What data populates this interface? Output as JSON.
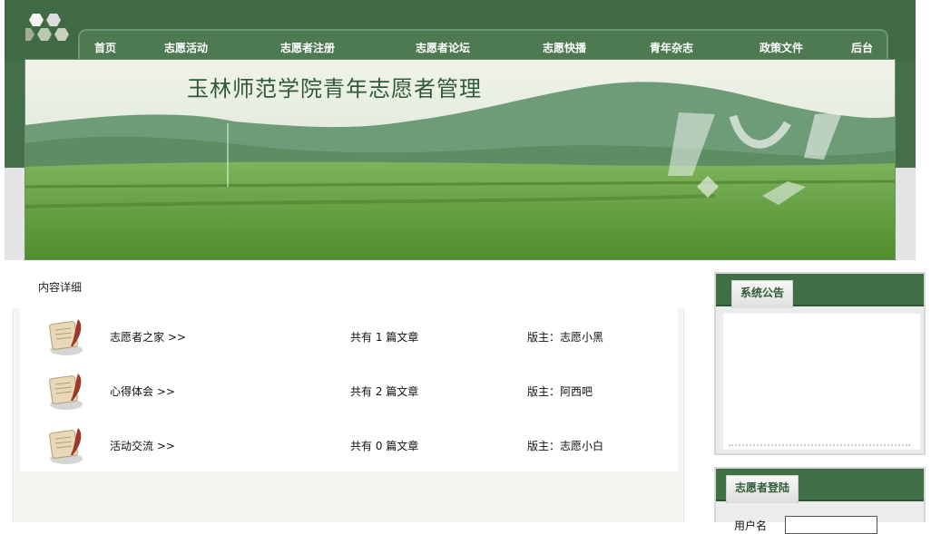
{
  "nav": {
    "items": [
      "首页",
      "志愿活动",
      "志愿者注册",
      "志愿者论坛",
      "志愿快播",
      "青年杂志",
      "政策文件",
      "后台"
    ]
  },
  "banner": {
    "title": "玉林师范学院青年志愿者管理"
  },
  "content": {
    "heading": "内容详细",
    "forums": [
      {
        "name": "志愿者之家 >>",
        "count": "共有 1 篇文章",
        "moderator": "版主：志愿小黑",
        "icon": "scroll-quill-icon"
      },
      {
        "name": "心得体会 >>",
        "count": "共有 2 篇文章",
        "moderator": "版主：阿西吧",
        "icon": "scroll-quill-icon"
      },
      {
        "name": "活动交流 >>",
        "count": "共有 0 篇文章",
        "moderator": "版主：志愿小白",
        "icon": "scroll-quill-icon"
      }
    ]
  },
  "sidebar": {
    "notice": {
      "title": "系统公告"
    },
    "login": {
      "title": "志愿者登陆",
      "username_label": "用户名",
      "username_value": ""
    }
  },
  "colors": {
    "brand_green": "#3f6a43",
    "nav_green": "#4d7a51",
    "panel_bg": "#f4f7f1"
  }
}
